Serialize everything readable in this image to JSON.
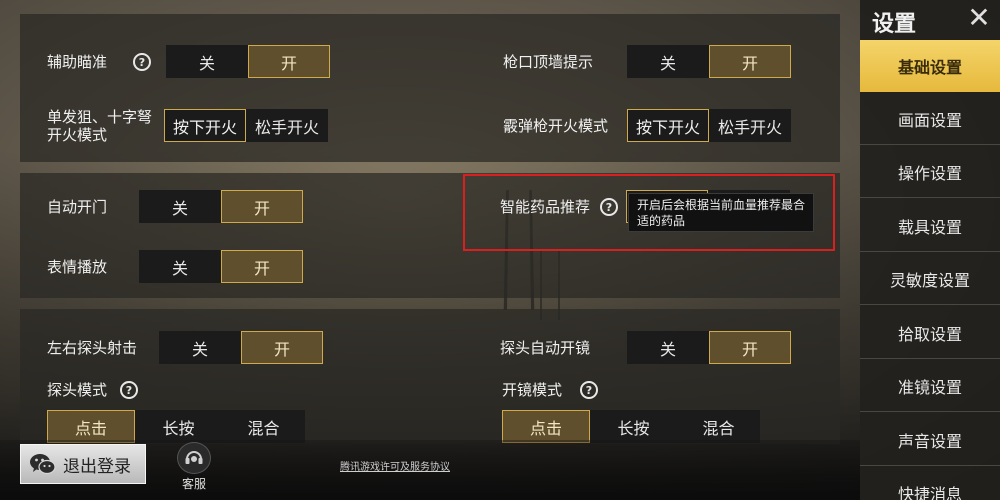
{
  "settings": {
    "aim_assist": {
      "label": "辅助瞄准",
      "off": "关",
      "on": "开",
      "selected": "on"
    },
    "muzzle_wall": {
      "label": "枪口顶墙提示",
      "off": "关",
      "on": "开",
      "selected": "on"
    },
    "single_fire": {
      "label": "单发狙、十字弩开火模式",
      "press": "按下开火",
      "release": "松手开火",
      "selected": "press"
    },
    "shotgun_fire": {
      "label": "霰弹枪开火模式",
      "press": "按下开火",
      "release": "松手开火",
      "selected": "press"
    },
    "auto_door": {
      "label": "自动开门",
      "off": "关",
      "on": "开",
      "selected": "on"
    },
    "med_recommend": {
      "label": "智能药品推荐",
      "tooltip": "开启后会根据当前血量推荐最合适的药品"
    },
    "emote": {
      "label": "表情播放",
      "off": "关",
      "on": "开",
      "selected": "on"
    },
    "peek_fire": {
      "label": "左右探头射击",
      "off": "关",
      "on": "开",
      "selected": "on"
    },
    "peek_scope": {
      "label": "探头自动开镜",
      "off": "关",
      "on": "开",
      "selected": "on"
    },
    "peek_mode": {
      "label": "探头模式",
      "tap": "点击",
      "hold": "长按",
      "mixed": "混合",
      "selected": "tap"
    },
    "scope_mode": {
      "label": "开镜模式",
      "tap": "点击",
      "hold": "长按",
      "mixed": "混合",
      "selected": "tap"
    }
  },
  "sidebar": {
    "title": "设置",
    "items": [
      {
        "label": "基础设置",
        "active": true
      },
      {
        "label": "画面设置"
      },
      {
        "label": "操作设置"
      },
      {
        "label": "载具设置"
      },
      {
        "label": "灵敏度设置"
      },
      {
        "label": "拾取设置"
      },
      {
        "label": "准镜设置"
      },
      {
        "label": "声音设置"
      },
      {
        "label": "快捷消息"
      }
    ]
  },
  "bottom": {
    "logout": "退出登录",
    "support": "客服",
    "license": "腾讯游戏许可及服务协议"
  },
  "help_glyph": "?",
  "close_glyph": "✕",
  "colors": {
    "accent": "#d0a94a",
    "active_tab": "#f0c850",
    "highlight_box": "#d92020"
  }
}
